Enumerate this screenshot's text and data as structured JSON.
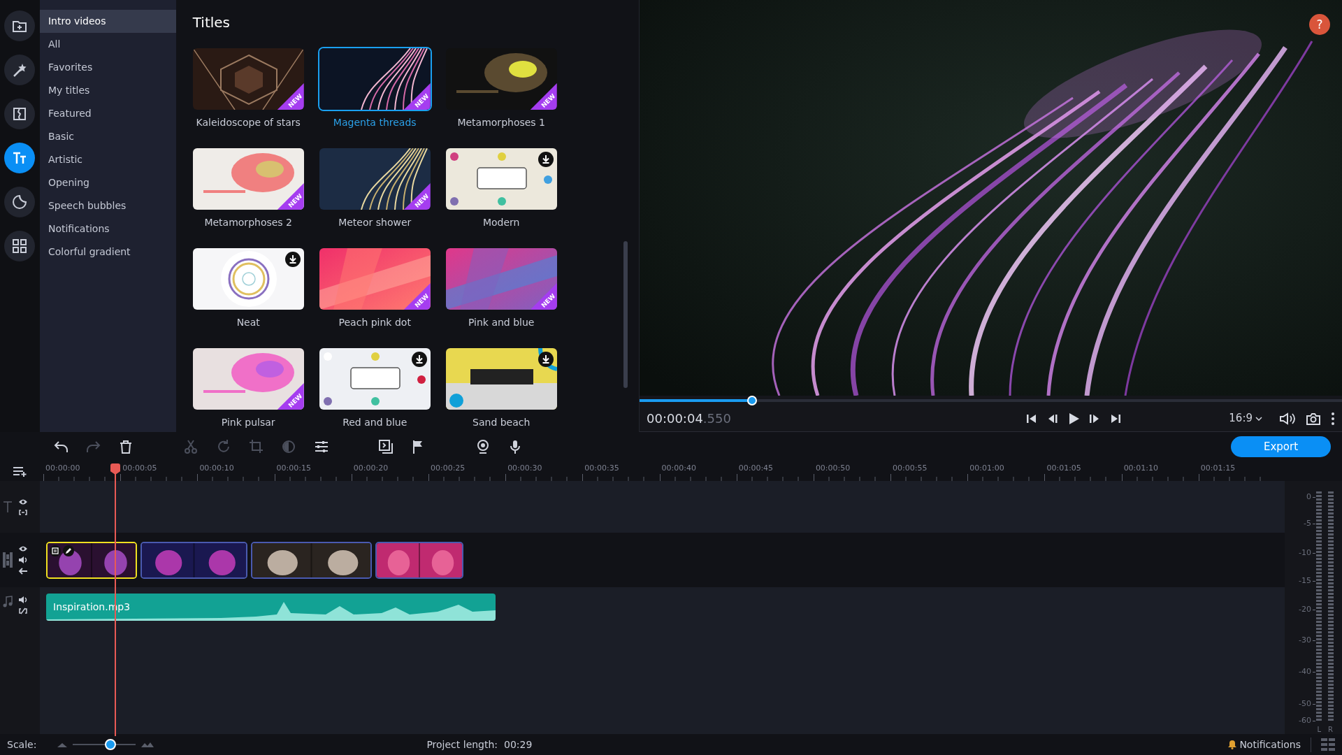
{
  "sidebar": {
    "tools": [
      {
        "kind": "import",
        "selected": false
      },
      {
        "kind": "effects",
        "selected": false
      },
      {
        "kind": "transitions",
        "selected": false
      },
      {
        "kind": "titles",
        "selected": true
      },
      {
        "kind": "stickers",
        "selected": false
      },
      {
        "kind": "more",
        "selected": false
      }
    ]
  },
  "categories": [
    {
      "label": "Intro videos",
      "selected": true
    },
    {
      "label": "All",
      "selected": false
    },
    {
      "label": "Favorites",
      "selected": false
    },
    {
      "label": "My titles",
      "selected": false
    },
    {
      "label": "Featured",
      "selected": false
    },
    {
      "label": "Basic",
      "selected": false
    },
    {
      "label": "Artistic",
      "selected": false
    },
    {
      "label": "Opening",
      "selected": false
    },
    {
      "label": "Speech bubbles",
      "selected": false
    },
    {
      "label": "Notifications",
      "selected": false
    },
    {
      "label": "Colorful gradient",
      "selected": false
    }
  ],
  "titles_panel": {
    "heading": "Titles",
    "items": [
      {
        "label": "Kaleidoscope of stars",
        "selected": false,
        "badge": "NEW",
        "download": false
      },
      {
        "label": "Magenta threads",
        "selected": true,
        "badge": "NEW",
        "download": false
      },
      {
        "label": "Metamorphoses 1",
        "selected": false,
        "badge": "NEW",
        "download": false
      },
      {
        "label": "Metamorphoses 2",
        "selected": false,
        "badge": "NEW",
        "download": false
      },
      {
        "label": "Meteor shower",
        "selected": false,
        "badge": "NEW",
        "download": false
      },
      {
        "label": "Modern",
        "selected": false,
        "download": true
      },
      {
        "label": "Neat",
        "selected": false,
        "download": true
      },
      {
        "label": "Peach pink dot",
        "selected": false,
        "badge": "NEW",
        "download": false
      },
      {
        "label": "Pink and blue",
        "selected": false,
        "badge": "NEW",
        "download": false
      },
      {
        "label": "Pink pulsar",
        "selected": false,
        "badge": "NEW",
        "download": false
      },
      {
        "label": "Red and blue",
        "selected": false,
        "download": true
      },
      {
        "label": "Sand beach",
        "selected": false,
        "download": true
      }
    ]
  },
  "preview": {
    "help": "?",
    "progress": {
      "level": 0.16
    },
    "time": "00:00:04",
    "time_fraction": ".550",
    "aspect": "16:9"
  },
  "timeline": {
    "tools": [
      {
        "kind": "undo",
        "disabled": false
      },
      {
        "kind": "redo",
        "disabled": true
      },
      {
        "kind": "delete",
        "disabled": false
      },
      {
        "kind": "cut",
        "disabled": true
      },
      {
        "kind": "rotate",
        "disabled": true
      },
      {
        "kind": "crop",
        "disabled": true
      },
      {
        "kind": "color",
        "disabled": true
      },
      {
        "kind": "adjust",
        "disabled": false
      },
      {
        "kind": "overlay",
        "disabled": false
      },
      {
        "kind": "marker",
        "disabled": false
      },
      {
        "kind": "webcam",
        "disabled": false
      },
      {
        "kind": "microphone",
        "disabled": false
      }
    ],
    "export": "Export",
    "ruler": [
      "00:00:00",
      "00:00:05",
      "00:00:10",
      "00:00:15",
      "00:00:20",
      "00:00:25",
      "00:00:30",
      "00:00:35",
      "00:00:40",
      "00:00:45",
      "00:00:50",
      "00:00:55",
      "00:01:00",
      "00:01:05",
      "00:01:10",
      "00:01:15"
    ],
    "clips": [
      {
        "kind": "title",
        "selected": true
      },
      {
        "kind": "video",
        "selected": false
      },
      {
        "kind": "video",
        "selected": false
      },
      {
        "kind": "video",
        "selected": false
      }
    ],
    "audio": {
      "name": "Inspiration.mp3"
    },
    "meter": {
      "scale": [
        "0",
        "-5",
        "-10",
        "-15",
        "-20",
        "-30",
        "-40",
        "-50",
        "-60"
      ],
      "channels": [
        "L",
        "R"
      ]
    }
  },
  "status_bar": {
    "scale_label": "Scale:",
    "scale": {
      "level": 0.6
    },
    "project_length": "Project length:  00:29",
    "notifications": "Notifications"
  }
}
